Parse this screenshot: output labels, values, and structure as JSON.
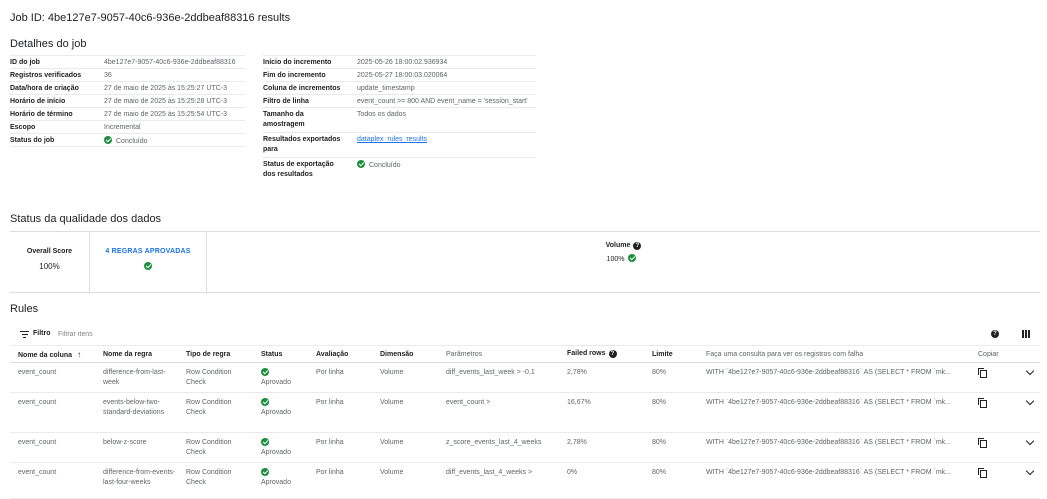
{
  "page": {
    "title": "Job ID: 4be127e7-9057-40c6-936e-2ddbeaf88316 results"
  },
  "details": {
    "title": "Detalhes do job",
    "left": [
      {
        "label": "ID do job",
        "value": "4be127e7-9057-40c6-936e-2ddbeaf88316"
      },
      {
        "label": "Registros verificados",
        "value": "36"
      },
      {
        "label": "Data/hora de criação",
        "value": "27 de maio de 2025 às 15:25:27 UTC-3"
      },
      {
        "label": "Horário de início",
        "value": "27 de maio de 2025 às 15:25:28 UTC-3"
      },
      {
        "label": "Horário de término",
        "value": "27 de maio de 2025 às 15:25:54 UTC-3"
      },
      {
        "label": "Escopo",
        "value": "Incremental"
      },
      {
        "label": "Status do job",
        "value": "Concluído"
      }
    ],
    "right": [
      {
        "label": "Início do incremento",
        "value": "2025-05-26 18:00:02.936934"
      },
      {
        "label": "Fim do incremento",
        "value": "2025-05-27 18:00:03.020064"
      },
      {
        "label": "Coluna de incrementos",
        "value": "update_timestamp"
      },
      {
        "label": "Filtro de linha",
        "value": "event_count >= 800 AND event_name = 'session_start'"
      },
      {
        "label": "Tamanho da amostragem",
        "value": "Todos os dados"
      },
      {
        "label": "Resultados exportados para",
        "value": "dataplex_rules_results"
      },
      {
        "label": "Status de exportação dos resultados",
        "value": "Concluído"
      }
    ]
  },
  "quality": {
    "title": "Status da qualidade dos dados",
    "overall_label": "Overall Score",
    "overall_value": "100%",
    "rules_passed": "4 REGRAS APROVADAS",
    "volume_label": "Volume",
    "volume_value": "100%"
  },
  "rules": {
    "title": "Rules",
    "filter_label": "Filtro",
    "filter_placeholder": "Filtrar itens",
    "columns": [
      "Nome da coluna",
      "Nome da regra",
      "Tipo de regra",
      "Status",
      "Avaliação",
      "Dimensão",
      "Parâmetros",
      "Failed rows",
      "Limite",
      "Faça uma consulta para ver os registros com falha",
      "Copiar"
    ],
    "rows": [
      {
        "column": "event_count",
        "rule": "difference-from-last-week",
        "type": "Row Condition Check",
        "status": "Aprovado",
        "eval": "Por linha",
        "dimension": "Volume",
        "params": "diff_events_last_week > -0.1",
        "failed": "2,78%",
        "limit": "80%",
        "query": "WITH `4be127e7-9057-40c6-936e-2ddbeaf88316` AS (SELECT * FROM `mk..."
      },
      {
        "column": "event_count",
        "rule": "events-below-two-standard-deviations",
        "type": "Row Condition Check",
        "status": "Aprovado",
        "eval": "Por linha",
        "dimension": "Volume",
        "params": "event_count >",
        "failed": "16,67%",
        "limit": "80%",
        "query": "WITH `4be127e7-9057-40c6-936e-2ddbeaf88316` AS (SELECT * FROM `mk..."
      },
      {
        "column": "event_count",
        "rule": "below-z-score",
        "type": "Row Condition Check",
        "status": "Aprovado",
        "eval": "Por linha",
        "dimension": "Volume",
        "params": "z_score_events_last_4_weeks",
        "failed": "2,78%",
        "limit": "80%",
        "query": "WITH `4be127e7-9057-40c6-936e-2ddbeaf88316` AS (SELECT * FROM `mk..."
      },
      {
        "column": "event_count",
        "rule": "difference-from-events-last-four-weeks",
        "type": "Row Condition Check",
        "status": "Aprovado",
        "eval": "Por linha",
        "dimension": "Volume",
        "params": "diff_events_last_4_weeks >",
        "failed": "0%",
        "limit": "80%",
        "query": "WITH `4be127e7-9057-40c6-936e-2ddbeaf88316` AS (SELECT * FROM `mk..."
      }
    ]
  },
  "colors": {
    "accent": "#1a73e8",
    "success": "#1e8e3e"
  }
}
